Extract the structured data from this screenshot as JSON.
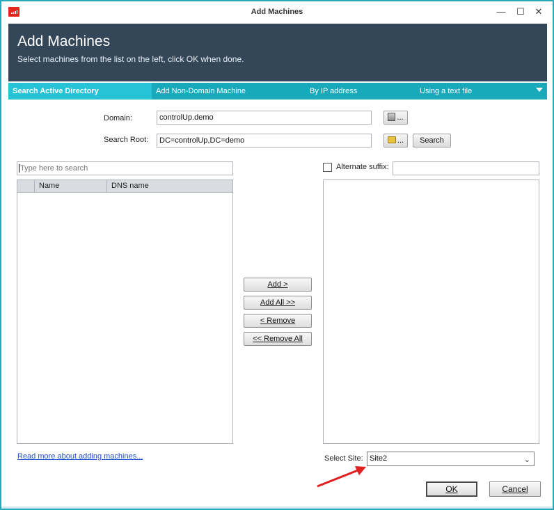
{
  "window": {
    "title": "Add Machines",
    "controls": {
      "minimize": "—",
      "maximize": "☐",
      "close": "✕"
    }
  },
  "header": {
    "title": "Add Machines",
    "subtitle": "Select machines from the list on the left, click OK when done."
  },
  "tabs": [
    {
      "label": "Search Active Directory",
      "active": true
    },
    {
      "label": "Add Non-Domain Machine",
      "active": false
    },
    {
      "label": "By IP address",
      "active": false
    },
    {
      "label": "Using a text file",
      "active": false
    }
  ],
  "search_form": {
    "domain_label": "Domain:",
    "domain_value": "controlUp.demo",
    "domain_browse_label": "...",
    "search_root_label": "Search Root:",
    "search_root_value": "DC=controlUp,DC=demo",
    "search_root_browse_label": "...",
    "search_button": "Search"
  },
  "left_panel": {
    "search_placeholder": "Type here to search",
    "columns": [
      "Name",
      "DNS name"
    ]
  },
  "middle_buttons": {
    "add": "Add >",
    "add_all": "Add All >>",
    "remove": "< Remove",
    "remove_all": "<< Remove All"
  },
  "right_panel": {
    "alternate_suffix_label": "Alternate suffix:",
    "alternate_suffix_checked": false,
    "alternate_suffix_value": ""
  },
  "footer": {
    "read_more_link": "Read more about adding machines...",
    "select_site_label": "Select Site:",
    "select_site_value": "Site2",
    "ok_button": "OK",
    "cancel_button": "Cancel"
  },
  "colors": {
    "header_bg": "#344758",
    "tab_bar": "#18a9bb",
    "tab_active": "#26c2d5",
    "window_border": "#2aa8b8",
    "annotation_arrow": "#e02020"
  }
}
